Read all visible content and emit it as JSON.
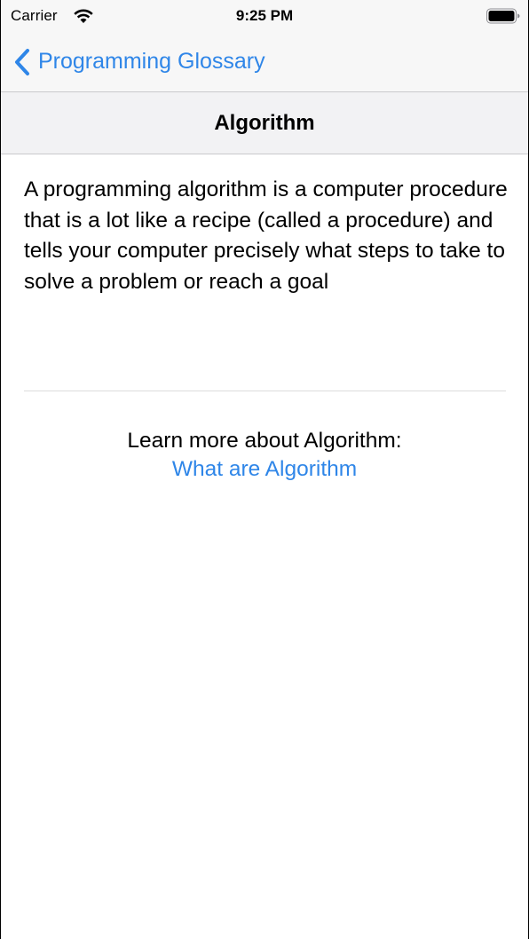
{
  "status_bar": {
    "carrier": "Carrier",
    "time": "9:25 PM",
    "icons": [
      "wifi-icon",
      "battery-icon"
    ]
  },
  "nav": {
    "back_label": "Programming Glossary",
    "back_icon": "chevron-left-icon",
    "accent_color": "#2f86e8"
  },
  "section": {
    "title": "Algorithm"
  },
  "content": {
    "description": "A programming algorithm is a computer procedure that is a lot like a recipe (called a procedure) and tells your computer precisely what steps to take to solve a problem or reach a goal",
    "learn_more_label": "Learn more about Algorithm:",
    "link_text": "What are Algorithm"
  }
}
